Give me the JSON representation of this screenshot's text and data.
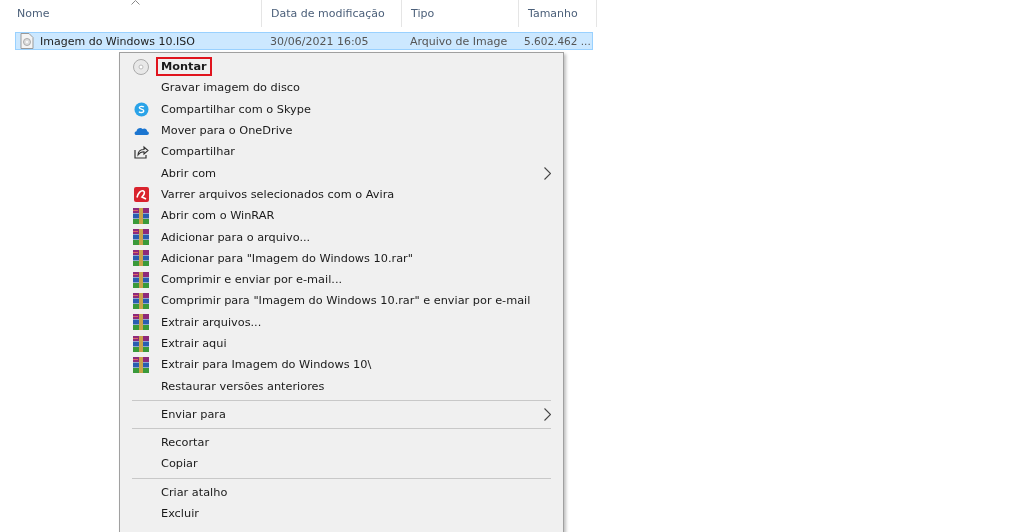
{
  "columns": [
    {
      "label": "Nome",
      "sorted": true
    },
    {
      "label": "Data de modificação",
      "sorted": false
    },
    {
      "label": "Tipo",
      "sorted": false
    },
    {
      "label": "Tamanho",
      "sorted": false
    }
  ],
  "file": {
    "name": "Imagem do Windows 10.ISO",
    "date": "30/06/2021 16:05",
    "type": "Arquivo de Image",
    "size": "5.602.462 ...",
    "selected": true
  },
  "menu": [
    {
      "items": [
        {
          "label": "Montar",
          "kind": "disc",
          "default": true,
          "highlighted": true,
          "submenu": false
        },
        {
          "label": "Gravar imagem do disco",
          "kind": "plain",
          "default": false,
          "highlighted": false,
          "submenu": false
        },
        {
          "label": "Compartilhar com o Skype",
          "kind": "skype",
          "default": false,
          "highlighted": false,
          "submenu": false
        },
        {
          "label": "Mover para o OneDrive",
          "kind": "onedrive",
          "default": false,
          "highlighted": false,
          "submenu": false
        },
        {
          "label": "Compartilhar",
          "kind": "share",
          "default": false,
          "highlighted": false,
          "submenu": false
        },
        {
          "label": "Abrir com",
          "kind": "plain",
          "default": false,
          "highlighted": false,
          "submenu": true
        },
        {
          "label": "Varrer arquivos selecionados com o Avira",
          "kind": "avira",
          "default": false,
          "highlighted": false,
          "submenu": false
        },
        {
          "label": "Abrir com o WinRAR",
          "kind": "winrar",
          "default": false,
          "highlighted": false,
          "submenu": false
        },
        {
          "label": "Adicionar para o arquivo...",
          "kind": "winrar",
          "default": false,
          "highlighted": false,
          "submenu": false
        },
        {
          "label": "Adicionar para \"Imagem do Windows 10.rar\"",
          "kind": "winrar",
          "default": false,
          "highlighted": false,
          "submenu": false
        },
        {
          "label": "Comprimir e enviar por e-mail...",
          "kind": "winrar",
          "default": false,
          "highlighted": false,
          "submenu": false
        },
        {
          "label": "Comprimir para \"Imagem do Windows 10.rar\" e enviar por e-mail",
          "kind": "winrar",
          "default": false,
          "highlighted": false,
          "submenu": false
        },
        {
          "label": "Extrair arquivos...",
          "kind": "winrar",
          "default": false,
          "highlighted": false,
          "submenu": false
        },
        {
          "label": "Extrair aqui",
          "kind": "winrar",
          "default": false,
          "highlighted": false,
          "submenu": false
        },
        {
          "label": "Extrair para Imagem do Windows 10\\",
          "kind": "winrar",
          "default": false,
          "highlighted": false,
          "submenu": false
        },
        {
          "label": "Restaurar versões anteriores",
          "kind": "plain",
          "default": false,
          "highlighted": false,
          "submenu": false
        }
      ]
    },
    {
      "items": [
        {
          "label": "Enviar para",
          "kind": "plain",
          "default": false,
          "highlighted": false,
          "submenu": true
        }
      ]
    },
    {
      "items": [
        {
          "label": "Recortar",
          "kind": "plain",
          "default": false,
          "highlighted": false,
          "submenu": false
        },
        {
          "label": "Copiar",
          "kind": "plain",
          "default": false,
          "highlighted": false,
          "submenu": false
        }
      ]
    },
    {
      "items": [
        {
          "label": "Criar atalho",
          "kind": "plain",
          "default": false,
          "highlighted": false,
          "submenu": false
        },
        {
          "label": "Excluir",
          "kind": "plain",
          "default": false,
          "highlighted": false,
          "submenu": false
        }
      ]
    }
  ]
}
